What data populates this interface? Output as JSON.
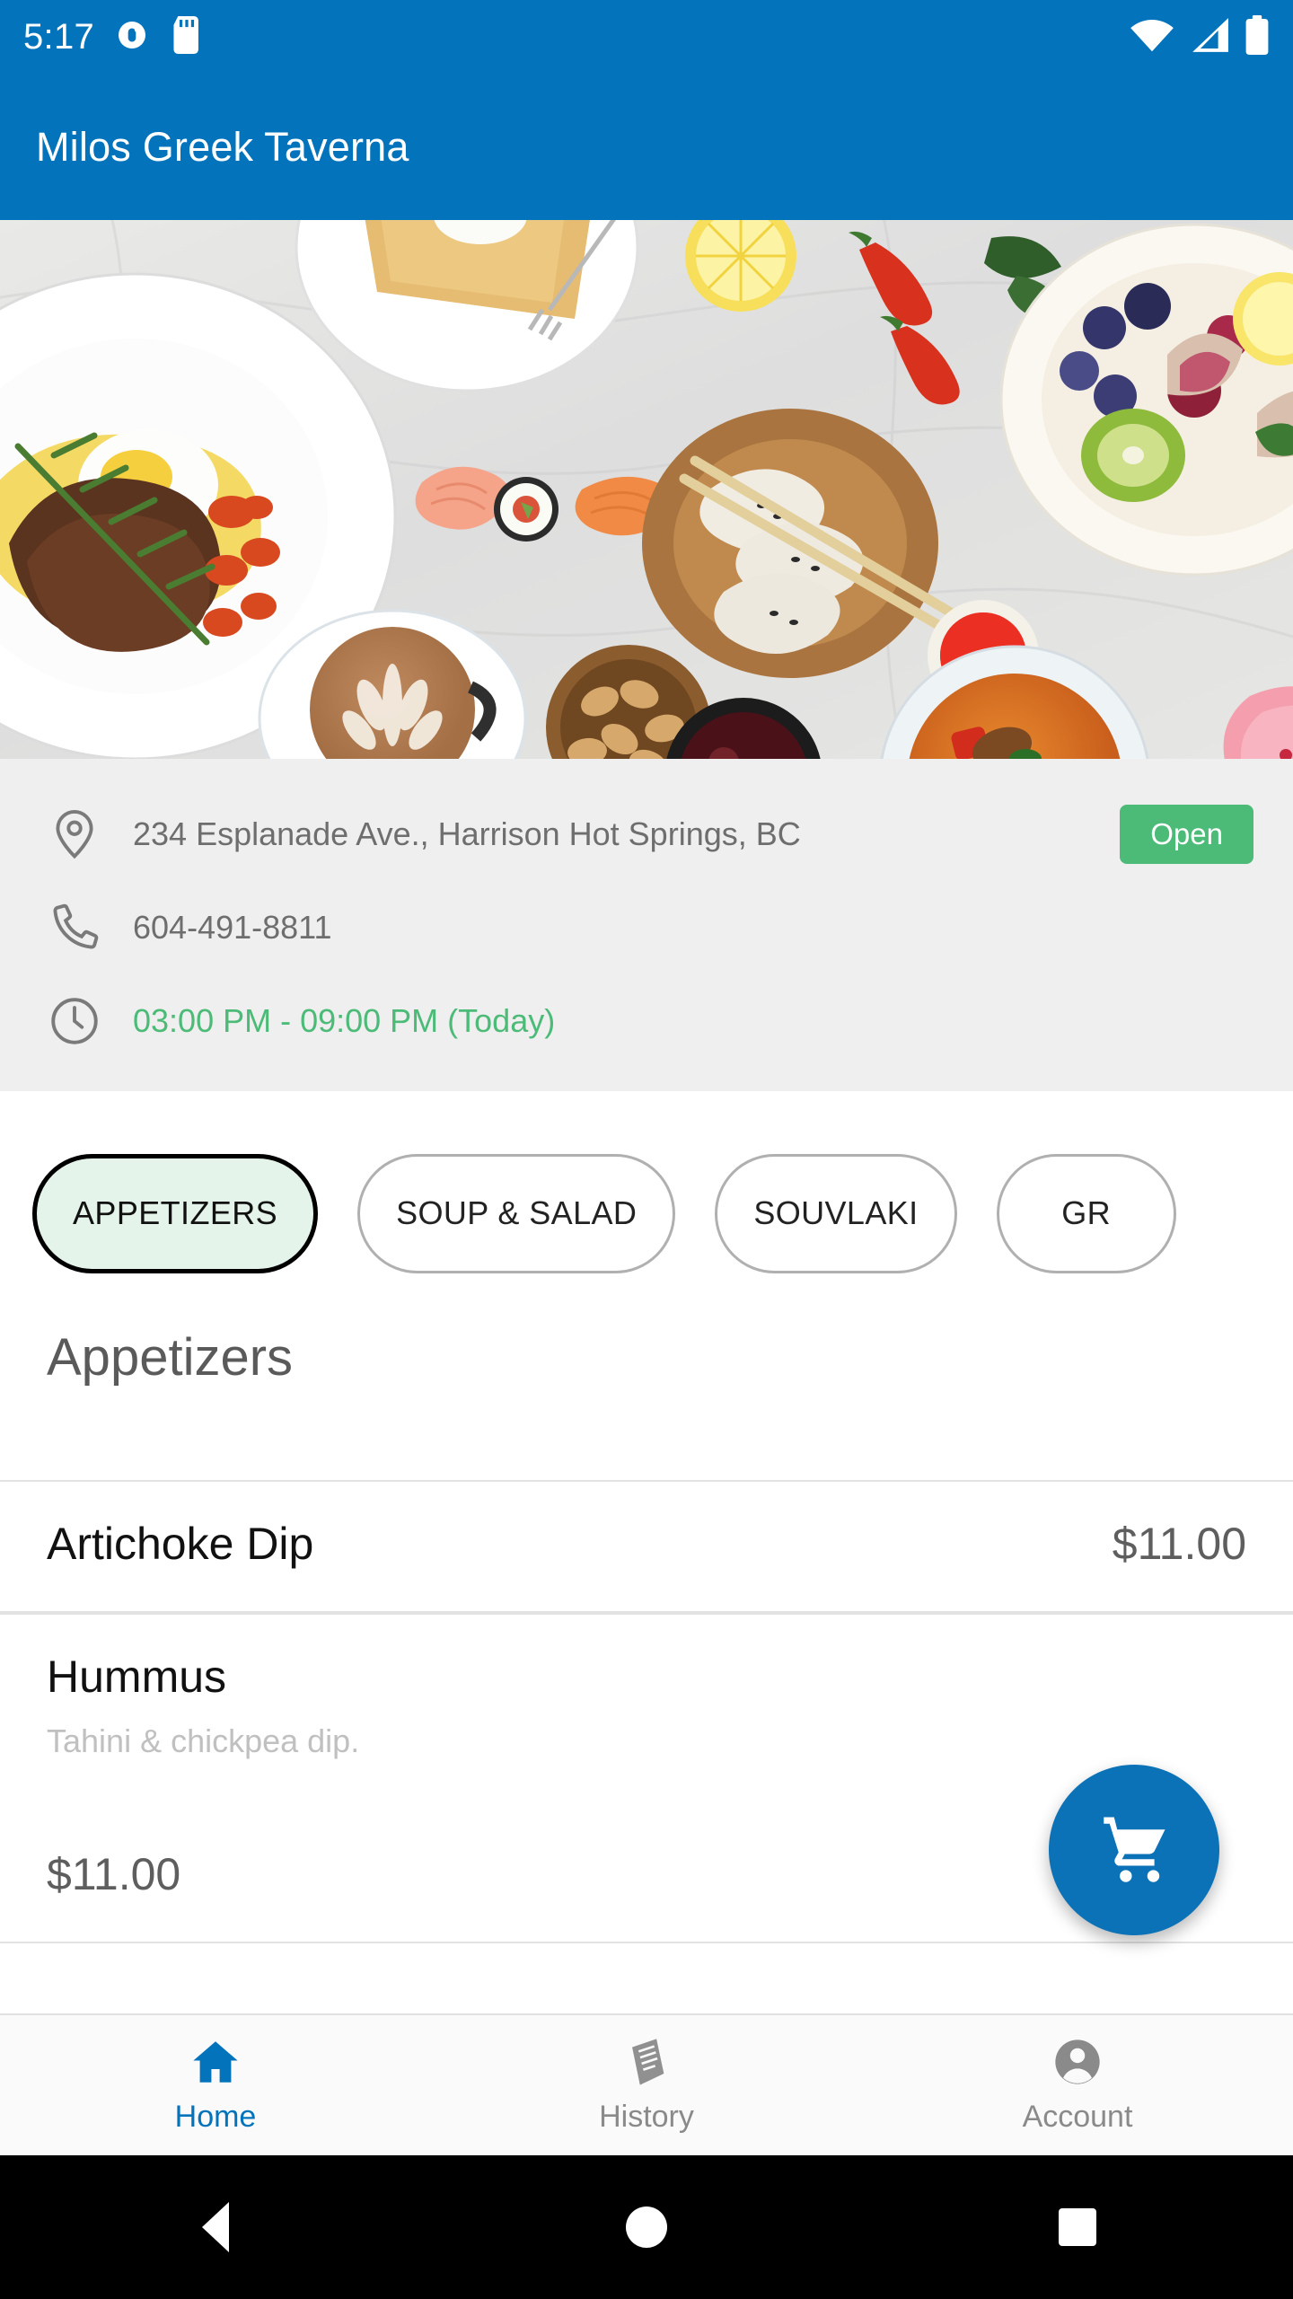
{
  "status_bar": {
    "time": "5:17",
    "left_icons": [
      "location-off-icon",
      "sd-card-icon"
    ],
    "right_icons": [
      "wifi-icon",
      "cellular-signal-icon",
      "battery-icon"
    ]
  },
  "app_bar": {
    "title": "Milos Greek Taverna",
    "background_color": "#0373BC"
  },
  "hero": {
    "alt": "overhead photo of assorted dishes on a marble table"
  },
  "info": {
    "address": "234 Esplanade Ave., Harrison Hot Springs, BC",
    "address_icon": "location-pin-icon",
    "phone": "604-491-8811",
    "phone_icon": "phone-icon",
    "hours": "03:00 PM - 09:00 PM (Today)",
    "hours_icon": "clock-icon",
    "status_badge": "Open",
    "status_color": "#4CBB78",
    "hours_color": "#4CBB78"
  },
  "categories": {
    "selected": "APPETIZERS",
    "selected_bg": "#e4f4ea",
    "items": [
      {
        "label": "APPETIZERS",
        "selected": true
      },
      {
        "label": "SOUP & SALAD",
        "selected": false
      },
      {
        "label": "SOUVLAKI",
        "selected": false
      },
      {
        "label": "GR",
        "selected": false
      }
    ]
  },
  "menu": {
    "section_title": "Appetizers",
    "items": [
      {
        "name": "Artichoke Dip",
        "description": "",
        "price": "$11.00",
        "price_position": "right"
      },
      {
        "name": "Hummus",
        "description": "Tahini & chickpea dip.",
        "price": "$11.00",
        "price_position": "bottom"
      }
    ]
  },
  "fab": {
    "icon": "shopping-cart-icon",
    "color": "#0C72B7"
  },
  "bottom_nav": {
    "active": "Home",
    "accent_color": "#0373BC",
    "items": [
      {
        "label": "Home",
        "icon": "home-icon",
        "active": true
      },
      {
        "label": "History",
        "icon": "receipt-icon",
        "active": false
      },
      {
        "label": "Account",
        "icon": "account-circle-icon",
        "active": false
      }
    ]
  },
  "android_nav": {
    "buttons": [
      "back-icon",
      "home-circle-icon",
      "recents-square-icon"
    ]
  }
}
